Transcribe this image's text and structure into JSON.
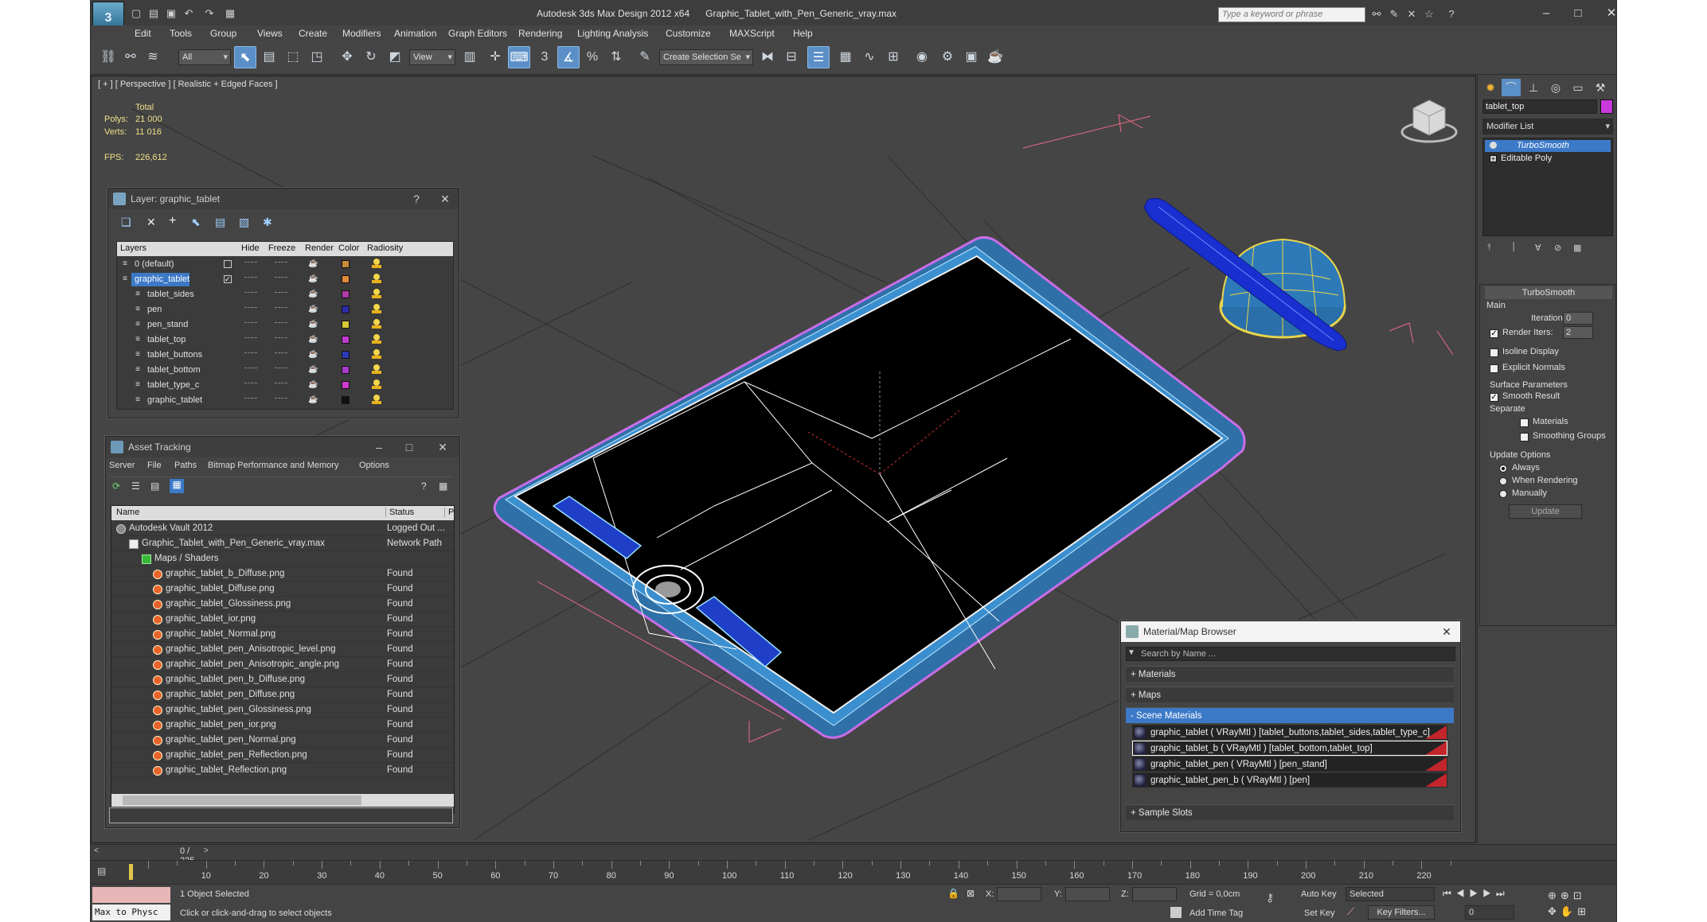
{
  "window": {
    "app_title": "Autodesk 3ds Max Design 2012 x64",
    "file_title": "Graphic_Tablet_with_Pen_Generic_vray.max",
    "search_placeholder": "Type a keyword or phrase"
  },
  "menu": [
    "Edit",
    "Tools",
    "Group",
    "Views",
    "Create",
    "Modifiers",
    "Animation",
    "Graph Editors",
    "Rendering",
    "Lighting Analysis",
    "Customize",
    "MAXScript",
    "Help"
  ],
  "toolbar": {
    "selection_filter": "All",
    "ref_coord": "View",
    "named_selection": "Create Selection Se"
  },
  "viewport": {
    "label": "[ + ] [ Perspective ] [ Realistic + Edged Faces ]",
    "stats_header": "Total",
    "polys_label": "Polys:",
    "polys_value": "21 000",
    "verts_label": "Verts:",
    "verts_value": "11 016",
    "fps_label": "FPS:",
    "fps_value": "226,612"
  },
  "layer_panel": {
    "title": "Layer: graphic_tablet",
    "columns": [
      "Layers",
      "Hide",
      "Freeze",
      "Render",
      "Color",
      "Radiosity"
    ],
    "rows": [
      {
        "name": "0 (default)",
        "color": "#c98a3a"
      },
      {
        "name": "graphic_tablet",
        "color": "#e08a3a"
      },
      {
        "name": "tablet_sides",
        "color": "#b03aa6"
      },
      {
        "name": "pen",
        "color": "#2a2aa8"
      },
      {
        "name": "pen_stand",
        "color": "#d8c83a"
      },
      {
        "name": "tablet_top",
        "color": "#c03ad0"
      },
      {
        "name": "tablet_buttons",
        "color": "#2a3ab8"
      },
      {
        "name": "tablet_bottom",
        "color": "#a83acc"
      },
      {
        "name": "tablet_type_c",
        "color": "#d03ad0"
      },
      {
        "name": "graphic_tablet",
        "color": "#111111"
      }
    ]
  },
  "asset_panel": {
    "title": "Asset Tracking",
    "menu": [
      "Server",
      "File",
      "Paths",
      "Bitmap Performance and Memory",
      "Options"
    ],
    "col_name": "Name",
    "col_status": "Status",
    "col_extra": "P",
    "rows": [
      {
        "name": "Autodesk Vault 2012",
        "status": "Logged Out ..."
      },
      {
        "name": "Graphic_Tablet_with_Pen_Generic_vray.max",
        "status": "Network Path"
      },
      {
        "name": "Maps / Shaders",
        "status": ""
      },
      {
        "name": "graphic_tablet_b_Diffuse.png",
        "status": "Found"
      },
      {
        "name": "graphic_tablet_Diffuse.png",
        "status": "Found"
      },
      {
        "name": "graphic_tablet_Glossiness.png",
        "status": "Found"
      },
      {
        "name": "graphic_tablet_ior.png",
        "status": "Found"
      },
      {
        "name": "graphic_tablet_Normal.png",
        "status": "Found"
      },
      {
        "name": "graphic_tablet_pen_Anisotropic_level.png",
        "status": "Found"
      },
      {
        "name": "graphic_tablet_pen_Anisotropic_angle.png",
        "status": "Found"
      },
      {
        "name": "graphic_tablet_pen_b_Diffuse.png",
        "status": "Found"
      },
      {
        "name": "graphic_tablet_pen_Diffuse.png",
        "status": "Found"
      },
      {
        "name": "graphic_tablet_pen_Glossiness.png",
        "status": "Found"
      },
      {
        "name": "graphic_tablet_pen_ior.png",
        "status": "Found"
      },
      {
        "name": "graphic_tablet_pen_Normal.png",
        "status": "Found"
      },
      {
        "name": "graphic_tablet_pen_Reflection.png",
        "status": "Found"
      },
      {
        "name": "graphic_tablet_Reflection.png",
        "status": "Found"
      }
    ]
  },
  "material_browser": {
    "title": "Material/Map Browser",
    "search_placeholder": "Search by Name ...",
    "sections": [
      "+ Materials",
      "+ Maps",
      "- Scene Materials",
      "+ Sample Slots"
    ],
    "materials": [
      "graphic_tablet  ( VRayMtl ) [tablet_buttons,tablet_sides,tablet_type_c]",
      "graphic_tablet_b  ( VRayMtl ) [tablet_bottom,tablet_top]",
      "graphic_tablet_pen  ( VRayMtl ) [pen_stand]",
      "graphic_tablet_pen_b  ( VRayMtl ) [pen]"
    ]
  },
  "command_panel": {
    "object_name": "tablet_top",
    "modifier_list": "Modifier List",
    "stack": [
      "TurboSmooth",
      "Editable Poly"
    ],
    "rollout_title": "TurboSmooth",
    "main_label": "Main",
    "iterations_label": "Iterations:",
    "iterations_value": "0",
    "render_iters_label": "Render Iters:",
    "render_iters_value": "2",
    "isoline_label": "Isoline Display",
    "explicit_label": "Explicit Normals",
    "surface_params_label": "Surface Parameters",
    "smooth_result_label": "Smooth Result",
    "separate_label": "Separate",
    "materials_label": "Materials",
    "smoothing_groups_label": "Smoothing Groups",
    "update_options_label": "Update Options",
    "always_label": "Always",
    "when_rendering_label": "When Rendering",
    "manually_label": "Manually",
    "update_button": "Update"
  },
  "timeline": {
    "frame_counter": "0 / 225",
    "ticks": [
      "10",
      "20",
      "30",
      "40",
      "50",
      "60",
      "70",
      "80",
      "90",
      "100",
      "110",
      "120",
      "130",
      "140",
      "150",
      "160",
      "170",
      "180",
      "190",
      "200",
      "210",
      "220"
    ]
  },
  "status": {
    "maxscript": "Max to Physc",
    "selection": "1 Object Selected",
    "prompt": "Click or click-and-drag to select objects",
    "x_label": "X:",
    "y_label": "Y:",
    "z_label": "Z:",
    "grid": "Grid = 0,0cm",
    "add_time_tag": "Add Time Tag",
    "auto_key": "Auto Key",
    "set_key": "Set Key",
    "selected": "Selected",
    "key_filters": "Key Filters...",
    "frame": "0"
  }
}
